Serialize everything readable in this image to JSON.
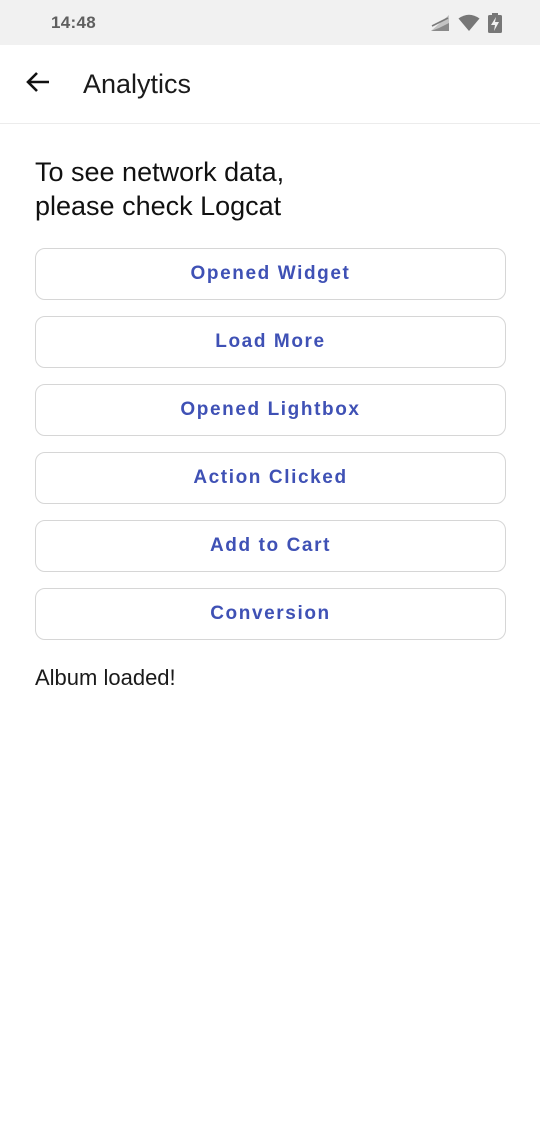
{
  "status_bar": {
    "time": "14:48",
    "icons": [
      "signal-icon",
      "wifi-icon",
      "battery-charging-icon"
    ]
  },
  "app_bar": {
    "back_icon": "arrow-left-icon",
    "title": "Analytics"
  },
  "main": {
    "heading": "To see network data,\nplease check Logcat",
    "buttons": [
      {
        "label": "Opened Widget"
      },
      {
        "label": "Load More"
      },
      {
        "label": "Opened Lightbox"
      },
      {
        "label": "Action Clicked"
      },
      {
        "label": "Add to Cart"
      },
      {
        "label": "Conversion"
      }
    ],
    "status_message": "Album loaded!"
  },
  "colors": {
    "accent": "#3f51b5",
    "status_bar_bg": "#f1f1f1",
    "button_border": "#d6d6d6"
  }
}
